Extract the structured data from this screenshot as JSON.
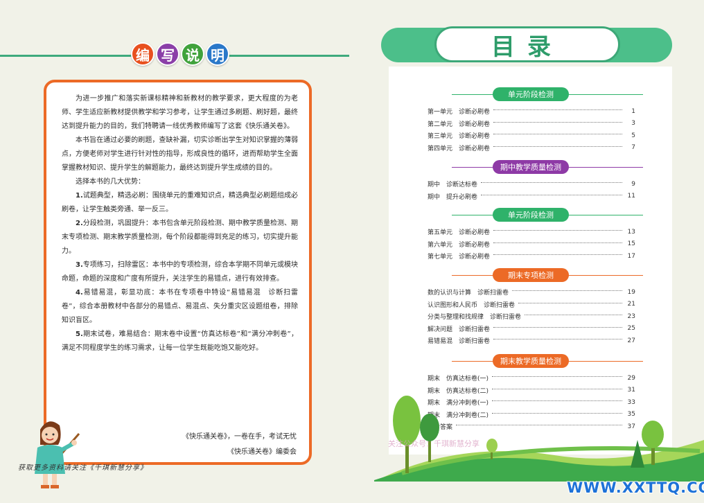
{
  "left": {
    "badges": [
      {
        "char": "编",
        "color": "#e8501e"
      },
      {
        "char": "写",
        "color": "#8b3fa8"
      },
      {
        "char": "说",
        "color": "#40a23c"
      },
      {
        "char": "明",
        "color": "#2a78c9"
      }
    ],
    "paragraphs": [
      {
        "lead": "",
        "text": "为进一步推广和落实新课标精神和新教材的教学要求，更大程度的为老师、学生适应新教材提供教学和学习参考，让学生通过多刷题、刷好题，最终达到提升能力的目的，我们特聘请一线优秀教师编写了这套《快乐通关卷》。"
      },
      {
        "lead": "",
        "text": "本书旨在通过必要的刷题，查缺补漏，切实诊断出学生对知识掌握的薄弱点，方便老师对学生进行针对性的指导，形成良性的循环，进而帮助学生全面掌握教材知识、提升学生的解题能力，最终达到提升学生成绩的目的。"
      },
      {
        "lead": "",
        "text": "选择本书的几大优势："
      },
      {
        "lead": "1.",
        "text": "试题典型，精选必刷：围绕单元的重难知识点，精选典型必刷题组成必刷卷，让学生触类旁通、举一反三。"
      },
      {
        "lead": "2.",
        "text": "分段检测，巩固提升：本书包含单元阶段检测、期中教学质量检测、期末专项检测、期末教学质量检测，每个阶段都能得到充足的练习，切实提升能力。"
      },
      {
        "lead": "3.",
        "text": "专项练习，扫除雷区：本书中的专项检测，综合本学期不同单元或模块命题，命题的深度和广度有所提升，关注学生的易错点，进行有效排查。"
      },
      {
        "lead": "4.",
        "text": "易错易混，彰显功底：本书在专项卷中特设“易错易混　诊断扫雷卷”，综合本册教材中各部分的易错点、易混点、失分重灾区设题组卷，排除知识盲区。"
      },
      {
        "lead": "5.",
        "text": "期末试卷，难易结合：期末卷中设置“仿真达标卷”和“满分冲刺卷”，满足不同程度学生的练习需求，让每一位学生既能吃饱又能吃好。"
      }
    ],
    "sign_line1": "《快乐通关卷》，一卷在手，考试无忧",
    "sign_line2": "《快乐通关卷》编委会",
    "bottom_note": "获取更多资料请关注《千琪新慧分享》"
  },
  "right": {
    "title": "目录",
    "sections": [
      {
        "label": "单元阶段检测",
        "color": "#2fb26a",
        "entries": [
          {
            "name": "第一单元　诊断必刷卷",
            "page": "1"
          },
          {
            "name": "第二单元　诊断必刷卷",
            "page": "3"
          },
          {
            "name": "第三单元　诊断必刷卷",
            "page": "5"
          },
          {
            "name": "第四单元　诊断必刷卷",
            "page": "7"
          }
        ]
      },
      {
        "label": "期中教学质量检测",
        "color": "#8e3aa6",
        "entries": [
          {
            "name": "期中　诊断达标卷",
            "page": "9"
          },
          {
            "name": "期中　提升必刷卷",
            "page": "11"
          }
        ]
      },
      {
        "label": "单元阶段检测",
        "color": "#2fb26a",
        "entries": [
          {
            "name": "第五单元　诊断必刷卷",
            "page": "13"
          },
          {
            "name": "第六单元　诊断必刷卷",
            "page": "15"
          },
          {
            "name": "第七单元　诊断必刷卷",
            "page": "17"
          }
        ]
      },
      {
        "label": "期末专项检测",
        "color": "#ec6a26",
        "entries": [
          {
            "name": "数的认识与计算　诊断扫雷卷",
            "page": "19"
          },
          {
            "name": "认识图形和人民币　诊断扫雷卷",
            "page": "21"
          },
          {
            "name": "分类与整理和找规律　诊断扫雷卷",
            "page": "23"
          },
          {
            "name": "解决问题　诊断扫雷卷",
            "page": "25"
          },
          {
            "name": "易错易混　诊断扫雷卷",
            "page": "27"
          }
        ]
      },
      {
        "label": "期末教学质量检测",
        "color": "#ec6a26",
        "entries": [
          {
            "name": "期末　仿真达标卷(一)",
            "page": "29"
          },
          {
            "name": "期末　仿真达标卷(二)",
            "page": "31"
          },
          {
            "name": "期末　满分冲刺卷(一)",
            "page": "33"
          },
          {
            "name": "期末　满分冲刺卷(二)",
            "page": "35"
          },
          {
            "name": "参考答案",
            "page": "37"
          }
        ]
      }
    ],
    "watermark": "关注公众号：千琪新慧分享",
    "site": "WWW.XXTTQ.COM"
  }
}
